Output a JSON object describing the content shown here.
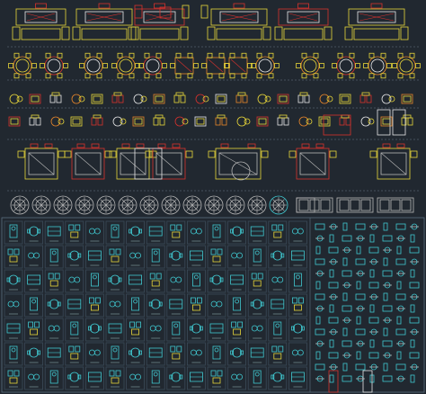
{
  "sheet": {
    "background": "#212830",
    "rows": [
      {
        "name": "living-room-sofa-sets",
        "colors": [
          "#e8d63a",
          "#d8322d",
          "#ffffff"
        ],
        "count": 6
      },
      {
        "name": "round-dining-tables",
        "colors": [
          "#e8d63a",
          "#d8322d",
          "#e8862a"
        ],
        "count": 13
      },
      {
        "name": "chair-and-table-blocks-row-1",
        "colors": [
          "#e8d63a",
          "#d8322d",
          "#ffffff"
        ],
        "count": 20
      },
      {
        "name": "chair-and-table-blocks-row-2",
        "colors": [
          "#e8d63a",
          "#d8322d",
          "#ffffff"
        ],
        "count": 20
      },
      {
        "name": "bedroom-sets",
        "colors": [
          "#e8d63a",
          "#d8322d",
          "#c8c8c8"
        ],
        "count": 11
      },
      {
        "name": "rugs-and-ceiling-medallions",
        "colors": [
          "#c8c8c8",
          "#40c8d0"
        ],
        "count": 16
      },
      {
        "name": "cyan-furniture-block-library",
        "colors": [
          "#40c8d0",
          "#e8d63a"
        ],
        "count": 96
      }
    ],
    "border_color": "#5a6f7f",
    "accent_cyan": "#40c8d0"
  }
}
